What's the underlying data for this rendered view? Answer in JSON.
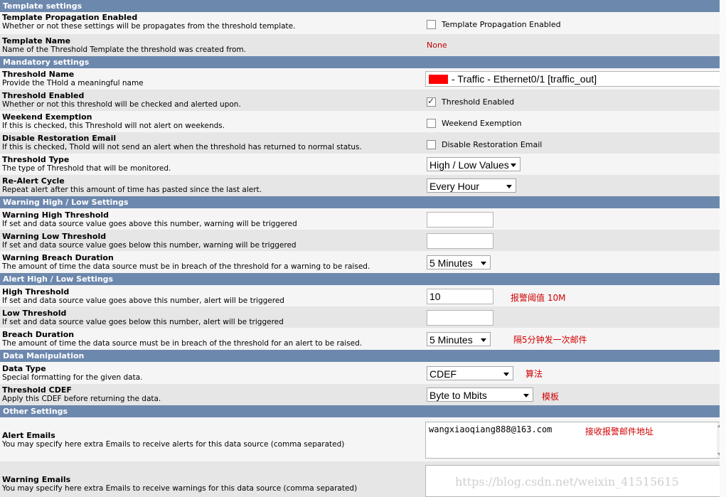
{
  "sections": {
    "template": "Template settings",
    "mandatory": "Mandatory settings",
    "warning": "Warning High / Low Settings",
    "alert": "Alert High / Low Settings",
    "data": "Data Manipulation",
    "other": "Other Settings"
  },
  "rows": {
    "template_propagation": {
      "title": "Template Propagation Enabled",
      "desc": "Whether or not these settings will be propagates from the threshold template.",
      "label": "Template Propagation Enabled",
      "checked": false
    },
    "template_name": {
      "title": "Template Name",
      "desc": "Name of the Threshold Template the threshold was created from.",
      "value": "None"
    },
    "threshold_name": {
      "title": "Threshold Name",
      "desc": "Provide the THold a meaningful name",
      "value": "- Traffic - Ethernet0/1 [traffic_out]",
      "swatch_color": "#ff0000"
    },
    "threshold_enabled": {
      "title": "Threshold Enabled",
      "desc": "Whether or not this threshold will be checked and alerted upon.",
      "label": "Threshold Enabled",
      "checked": true
    },
    "weekend_exemption": {
      "title": "Weekend Exemption",
      "desc": "If this is checked, this Threshold will not alert on weekends.",
      "label": "Weekend Exemption",
      "checked": false
    },
    "disable_restoration": {
      "title": "Disable Restoration Email",
      "desc": "If this is checked, Thold will not send an alert when the threshold has returned to normal status.",
      "label": "Disable Restoration Email",
      "checked": false
    },
    "threshold_type": {
      "title": "Threshold Type",
      "desc": "The type of Threshold that will be monitored.",
      "value": "High / Low Values"
    },
    "realert_cycle": {
      "title": "Re-Alert Cycle",
      "desc": "Repeat alert after this amount of time has pasted since the last alert.",
      "value": "Every Hour"
    },
    "warning_high": {
      "title": "Warning High Threshold",
      "desc": "If set and data source value goes above this number, warning will be triggered",
      "value": ""
    },
    "warning_low": {
      "title": "Warning Low Threshold",
      "desc": "If set and data source value goes below this number, warning will be triggered",
      "value": ""
    },
    "warning_breach": {
      "title": "Warning Breach Duration",
      "desc": "The amount of time the data source must be in breach of the threshold for a warning to be raised.",
      "value": "5 Minutes"
    },
    "high_threshold": {
      "title": "High Threshold",
      "desc": "If set and data source value goes above this number, alert will be triggered",
      "value": "10",
      "note": "报警阈值 10M"
    },
    "low_threshold": {
      "title": "Low Threshold",
      "desc": "If set and data source value goes below this number, alert will be triggered",
      "value": ""
    },
    "breach_duration": {
      "title": "Breach Duration",
      "desc": "The amount of time the data source must be in breach of the threshold for an alert to be raised.",
      "value": "5 Minutes",
      "note": "隔5分钟发一次邮件"
    },
    "data_type": {
      "title": "Data Type",
      "desc": "Special formatting for the given data.",
      "value": "CDEF",
      "note": "算法"
    },
    "threshold_cdef": {
      "title": "Threshold CDEF",
      "desc": "Apply this CDEF before returning the data.",
      "value": "Byte to Mbits",
      "note": "模板"
    },
    "alert_emails": {
      "title": "Alert Emails",
      "desc": "You may specify here extra Emails to receive alerts for this data source (comma separated)",
      "value": "wangxiaoqiang888@163.com",
      "note": "接收报警邮件地址"
    },
    "warning_emails": {
      "title": "Warning Emails",
      "desc": "You may specify here extra Emails to receive warnings for this data source (comma separated)",
      "value": ""
    }
  },
  "watermark": "https://blog.csdn.net/weixin_41515615"
}
